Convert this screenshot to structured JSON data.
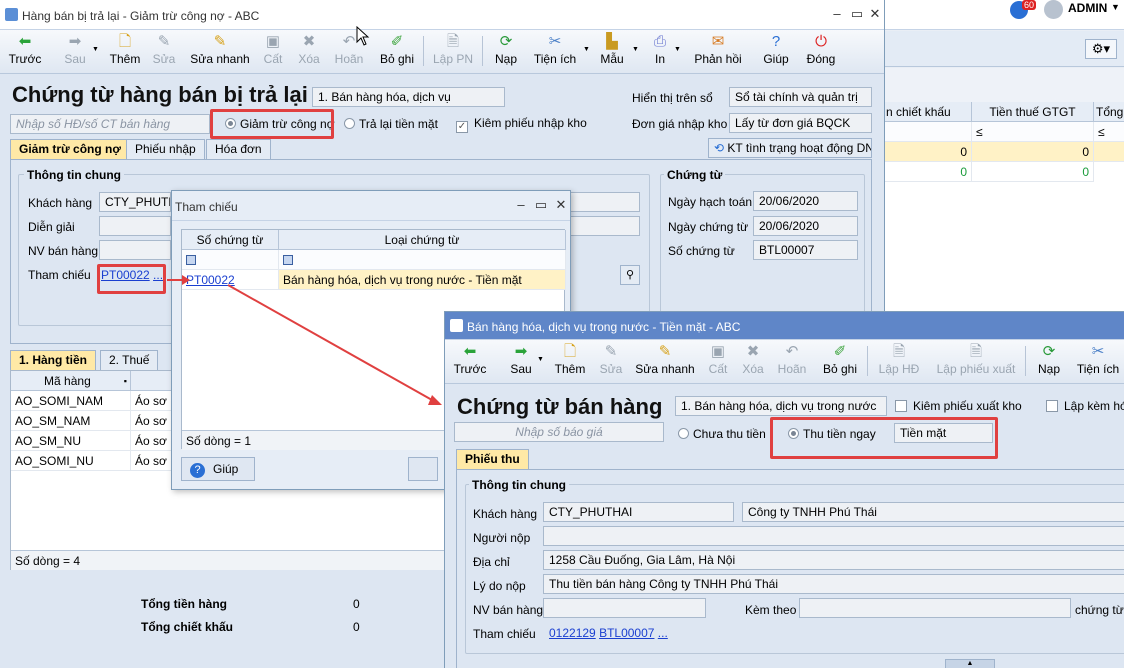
{
  "app": {
    "user": "ADMIN",
    "badge": "60"
  },
  "w1": {
    "title": "Hàng bán bị trả lại - Giảm trừ công nợ - ABC",
    "toolbar": [
      {
        "label": "Trước",
        "icon": "arrow-left-icon"
      },
      {
        "label": "Sau",
        "icon": "arrow-right-icon"
      },
      {
        "label": "Thêm",
        "icon": "add-document-icon"
      },
      {
        "label": "Sửa",
        "icon": "edit-icon"
      },
      {
        "label": "Sửa nhanh",
        "icon": "quick-edit-icon"
      },
      {
        "label": "Cất",
        "icon": "save-icon"
      },
      {
        "label": "Xóa",
        "icon": "delete-icon"
      },
      {
        "label": "Hoãn",
        "icon": "undo-icon"
      },
      {
        "label": "Bỏ ghi",
        "icon": "unpost-icon"
      },
      {
        "label": "Lập PN",
        "icon": "create-receipt-icon"
      },
      {
        "label": "Nạp",
        "icon": "refresh-icon"
      },
      {
        "label": "Tiện ích",
        "icon": "tools-icon"
      },
      {
        "label": "Mẫu",
        "icon": "chart-icon"
      },
      {
        "label": "In",
        "icon": "print-icon"
      },
      {
        "label": "Phản hồi",
        "icon": "mail-icon"
      },
      {
        "label": "Giúp",
        "icon": "help-icon"
      },
      {
        "label": "Đóng",
        "icon": "close-icon"
      }
    ],
    "header": "Chứng từ hàng bán bị trả lại",
    "type_value": "1. Bán hàng hóa, dịch vụ",
    "search_placeholder": "Nhập số HĐ/số CT bán hàng",
    "radio1": "Giảm trừ công nợ",
    "radio2": "Trả lại tiền mặt",
    "check1": "Kiêm phiếu nhập kho",
    "show_label": "Hiển thị trên sổ",
    "show_value": "Sổ tài chính và quản trị",
    "price_label": "Đơn giá nhập kho",
    "price_value": "Lấy từ đơn giá BQCK",
    "tabs": [
      "Giảm trừ công nợ",
      "Phiếu nhập",
      "Hóa đơn"
    ],
    "kt_button": "KT tình trạng hoạt động DN",
    "general": {
      "title": "Thông tin chung",
      "customer_label": "Khách hàng",
      "customer_value": "CTY_PHUTH...",
      "desc_label": "Diễn giải",
      "staff_label": "NV bán hàng",
      "ref_label": "Tham chiếu",
      "ref_value": "PT00022",
      "ref_more": "..."
    },
    "voucher": {
      "title": "Chứng từ",
      "posting_label": "Ngày hạch toán",
      "posting_value": "20/06/2020",
      "date_label": "Ngày chứng từ",
      "date_value": "20/06/2020",
      "no_label": "Số chứng từ",
      "no_value": "BTL00007"
    },
    "detail_tabs": [
      "1. Hàng tiền",
      "2. Thuế"
    ],
    "grid": {
      "col1": "Mã hàng",
      "col2": "",
      "rows": [
        {
          "code": "AO_SOMI_NAM",
          "name": "Áo sơ m"
        },
        {
          "code": "AO_SM_NAM",
          "name": "Áo sơ m"
        },
        {
          "code": "AO_SM_NU",
          "name": "Áo sơ m"
        },
        {
          "code": "AO_SOMI_NU",
          "name": "Áo sơ m"
        }
      ],
      "count": "Số dòng = 4"
    },
    "totals": {
      "goods_label": "Tổng tiền hàng",
      "goods_value": "0",
      "discount_label": "Tổng chiết khấu",
      "discount_value": "0"
    },
    "right_grid": {
      "col1": "n chiết khấu",
      "col2": "Tiền thuế GTGT",
      "col3": "Tổng t",
      "filter1": "≤",
      "filter2": "≤",
      "row1": [
        "0",
        "0"
      ],
      "row2": [
        "0",
        "0"
      ]
    }
  },
  "ref_dialog": {
    "title": "Tham chiếu",
    "col1": "Số chứng từ",
    "col2": "Loại chứng từ",
    "rows": [
      {
        "no": "PT00022",
        "type": "Bán hàng hóa, dịch vụ trong nước - Tiền mặt"
      }
    ],
    "count": "Số dòng = 1",
    "help": "Giúp"
  },
  "w2": {
    "title": "Bán hàng hóa, dịch vụ trong nước - Tiền mặt - ABC",
    "toolbar": [
      {
        "label": "Trước",
        "icon": "arrow-left-icon"
      },
      {
        "label": "Sau",
        "icon": "arrow-right-icon"
      },
      {
        "label": "Thêm",
        "icon": "add-document-icon"
      },
      {
        "label": "Sửa",
        "icon": "edit-icon"
      },
      {
        "label": "Sửa nhanh",
        "icon": "quick-edit-icon"
      },
      {
        "label": "Cất",
        "icon": "save-icon"
      },
      {
        "label": "Xóa",
        "icon": "delete-icon"
      },
      {
        "label": "Hoãn",
        "icon": "undo-icon"
      },
      {
        "label": "Bỏ ghi",
        "icon": "unpost-icon"
      },
      {
        "label": "Lập HĐ",
        "icon": "create-invoice-icon"
      },
      {
        "label": "Lập phiếu xuất",
        "icon": "create-issue-icon"
      },
      {
        "label": "Nạp",
        "icon": "refresh-icon"
      },
      {
        "label": "Tiện ích",
        "icon": "tools-icon"
      }
    ],
    "header": "Chứng từ bán hàng",
    "type_value": "1. Bán hàng hóa, dịch vụ trong nước",
    "check1": "Kiêm phiếu xuất kho",
    "check2": "Lập kèm hóa",
    "quote_placeholder": "Nhập số báo giá",
    "radio1": "Chưa thu tiền",
    "radio2": "Thu tiền ngay",
    "pay_value": "Tiền mặt",
    "tab": "Phiếu thu",
    "general": {
      "title": "Thông tin chung",
      "customer_label": "Khách hàng",
      "customer_code": "CTY_PHUTHAI",
      "customer_name": "Công ty TNHH Phú Thái",
      "payer_label": "Người nộp",
      "address_label": "Địa chỉ",
      "address_value": "1258 Cầu Đuống, Gia Lâm, Hà Nội",
      "reason_label": "Lý do nộp",
      "reason_value": "Thu tiền bán hàng Công ty TNHH Phú Thái",
      "staff_label": "NV bán hàng",
      "attach_label": "Kèm theo",
      "attach_suffix": "chứng từ g",
      "ref_label": "Tham chiếu",
      "ref1": "0122129",
      "ref2": "BTL00007",
      "ref_more": "..."
    }
  },
  "colors": {
    "accent": "#ffe9a6",
    "highlight": "#e04040",
    "link": "#1a3fd0"
  }
}
